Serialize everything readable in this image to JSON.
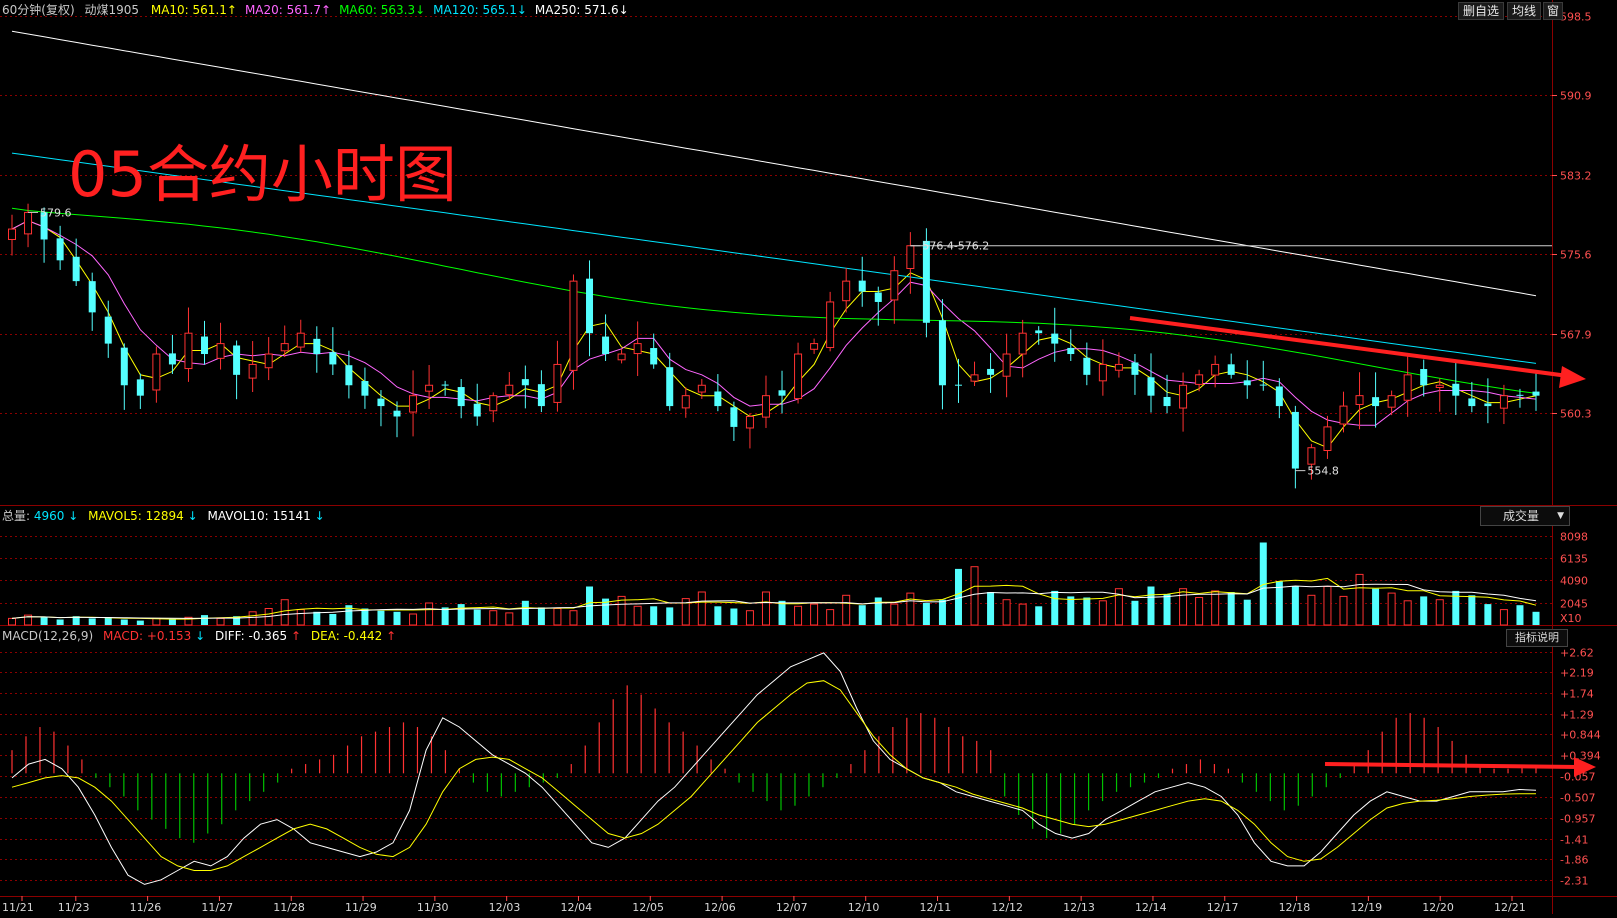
{
  "header": {
    "period": "60分钟(复权)",
    "symbol": "动煤1905",
    "ma": [
      {
        "label": "MA10:",
        "value": "561.1",
        "arrow": "↑",
        "color": "#ffff00"
      },
      {
        "label": "MA20:",
        "value": "561.7",
        "arrow": "↑",
        "color": "#ff66ff"
      },
      {
        "label": "MA60:",
        "value": "563.3",
        "arrow": "↓",
        "color": "#00ff00"
      },
      {
        "label": "MA120:",
        "value": "565.1",
        "arrow": "↓",
        "color": "#00e5ff"
      },
      {
        "label": "MA250:",
        "value": "571.6",
        "arrow": "↓",
        "color": "#ffffff"
      }
    ]
  },
  "toolbar": {
    "delete_label": "删自选",
    "avg_label": "均线",
    "window_label": "窗"
  },
  "annotation": {
    "title": "05合约小时图"
  },
  "volume_header": {
    "total": {
      "label": "总量:",
      "value": "4960",
      "arrow": "↓"
    },
    "mavol5": {
      "label": "MAVOL5:",
      "value": "12894",
      "arrow": "↓"
    },
    "mavol10": {
      "label": "MAVOL10:",
      "value": "15141",
      "arrow": "↓"
    },
    "selector": "成交量"
  },
  "macd_header": {
    "name": "MACD(12,26,9)",
    "macd": {
      "label": "MACD:",
      "value": "+0.153",
      "arrow": "↓"
    },
    "diff": {
      "label": "DIFF:",
      "value": "-0.365",
      "arrow": "↑"
    },
    "dea": {
      "label": "DEA:",
      "value": "-0.442",
      "arrow": "↑"
    },
    "help_button": "指标说明"
  },
  "colors": {
    "up": "#ff3232",
    "down": "#54ffff",
    "ma10": "#ffff00",
    "ma20": "#ff66ff",
    "ma60": "#00ff00",
    "ma120": "#00e5ff",
    "ma250": "#ffffff",
    "grid": "#8b0000",
    "axis_text": "#ff5050"
  },
  "chart_data": [
    {
      "type": "candlestick",
      "title": "05合约小时图",
      "y_ticks": [
        598.5,
        590.9,
        583.2,
        575.6,
        567.9,
        560.3
      ],
      "ylim": [
        551.5,
        600.0
      ],
      "x_labels": [
        "11/21",
        "11/23",
        "11/26",
        "11/27",
        "11/28",
        "11/29",
        "11/30",
        "12/03",
        "12/04",
        "12/05",
        "12/06",
        "12/07",
        "12/10",
        "12/11",
        "12/12",
        "12/13",
        "12/14",
        "12/17",
        "12/18",
        "12/19",
        "12/20",
        "12/21"
      ],
      "callouts": [
        "579.6",
        "576.4-576.2",
        "554.8"
      ],
      "key_points": [
        {
          "session": "11/21",
          "value": 579.6,
          "label": "579.6"
        },
        {
          "session": "12/10",
          "value": 576.4,
          "label": "576.4-576.2"
        },
        {
          "session": "12/18",
          "value": 554.8,
          "label": "554.8"
        }
      ],
      "series": [
        {
          "name": "MA10",
          "last": 561.1
        },
        {
          "name": "MA20",
          "last": 561.7
        },
        {
          "name": "MA60",
          "last": 563.3
        },
        {
          "name": "MA120",
          "last": 565.1
        },
        {
          "name": "MA250",
          "last": 571.6
        }
      ],
      "close_path": [
        578,
        579.6,
        577,
        575,
        573,
        570,
        567,
        563,
        562,
        566,
        565,
        568,
        566,
        567,
        564,
        565,
        566,
        567,
        568,
        566,
        565,
        563,
        562,
        561,
        560,
        562,
        563,
        563,
        561,
        560,
        562,
        563,
        563,
        561,
        565,
        573,
        568,
        566,
        566,
        567,
        565,
        561,
        562,
        563,
        561,
        559,
        560,
        562,
        562,
        566,
        567,
        571,
        573,
        572,
        571,
        574,
        576.4,
        569,
        563,
        563,
        564,
        564,
        566,
        568,
        568,
        567,
        566,
        564,
        565,
        565,
        564,
        562,
        561,
        563,
        564,
        565,
        564,
        563,
        563,
        561,
        555,
        557,
        559,
        561,
        562,
        561,
        562,
        564,
        563,
        563,
        562,
        561,
        561,
        562,
        562,
        562
      ]
    },
    {
      "type": "bar",
      "title": "成交量",
      "y_ticks": [
        8098,
        6135,
        4090,
        2045
      ],
      "y_unit": "X10",
      "series": [
        {
          "name": "总量",
          "last": 4960
        },
        {
          "name": "MAVOL5",
          "last": 12894
        },
        {
          "name": "MAVOL10",
          "last": 15141
        }
      ],
      "values": [
        600,
        900,
        700,
        500,
        800,
        600,
        700,
        500,
        400,
        600,
        500,
        700,
        900,
        600,
        800,
        1200,
        1500,
        2300,
        1400,
        1200,
        1000,
        1800,
        1500,
        1300,
        1200,
        1000,
        2000,
        1600,
        1900,
        1400,
        1300,
        1100,
        2200,
        1600,
        1500,
        1300,
        3500,
        2400,
        2600,
        1700,
        1700,
        1600,
        2400,
        3000,
        1700,
        1500,
        1300,
        3000,
        2200,
        1700,
        1900,
        1400,
        2700,
        1800,
        2500,
        1900,
        2900,
        2000,
        2300,
        5100,
        5300,
        3000,
        2300,
        1900,
        1700,
        3100,
        2600,
        2500,
        2200,
        3300,
        2200,
        3500,
        2800,
        3300,
        2500,
        3100,
        3000,
        2300,
        7500,
        4000,
        3500,
        2700,
        3500,
        2600,
        4600,
        3300,
        2900,
        2200,
        2600,
        2300,
        3100,
        2700,
        1900,
        1400,
        1800,
        1200
      ]
    },
    {
      "type": "bar",
      "title": "MACD(12,26,9)",
      "y_ticks": [
        2.62,
        2.19,
        1.74,
        1.29,
        0.844,
        0.394,
        -0.057,
        -0.507,
        -0.957,
        -1.41,
        -1.86,
        -2.31
      ],
      "y_tick_labels": [
        "+2.62",
        "+2.19",
        "+1.74",
        "+1.29",
        "+0.844",
        "+0.394",
        "-0.057",
        "-0.507",
        "-0.957",
        "-1.41",
        "-1.86",
        "-2.31"
      ],
      "ylim": [
        -2.65,
        2.75
      ],
      "series": [
        {
          "name": "MACD",
          "last": 0.153
        },
        {
          "name": "DIFF",
          "last": -0.365
        },
        {
          "name": "DEA",
          "last": -0.442
        }
      ],
      "macd_hist": [
        0.5,
        0.8,
        1.0,
        0.9,
        0.6,
        0.3,
        -0.1,
        -0.3,
        -0.5,
        -0.8,
        -1.0,
        -1.2,
        -1.4,
        -1.5,
        -1.3,
        -1.1,
        -0.8,
        -0.6,
        -0.4,
        -0.2,
        0.1,
        0.2,
        0.3,
        0.4,
        0.6,
        0.8,
        0.9,
        1.0,
        1.1,
        1.0,
        0.8,
        0.5,
        0.1,
        -0.2,
        -0.4,
        -0.5,
        -0.4,
        -0.3,
        -0.2,
        -0.1,
        0.2,
        0.6,
        1.1,
        1.6,
        1.9,
        1.7,
        1.4,
        1.1,
        0.9,
        0.6,
        0.3,
        0.1,
        -0.2,
        -0.4,
        -0.6,
        -0.8,
        -0.7,
        -0.5,
        -0.3,
        -0.1,
        0.2,
        0.5,
        0.8,
        1.0,
        1.2,
        1.3,
        1.2,
        1.0,
        0.8,
        0.7,
        0.5,
        -0.5,
        -0.9,
        -1.2,
        -1.4,
        -1.3,
        -1.1,
        -0.8,
        -0.6,
        -0.4,
        -0.3,
        -0.2,
        -0.1,
        0.1,
        0.2,
        0.3,
        0.2,
        0.1,
        -0.2,
        -0.4,
        -0.6,
        -0.8,
        -0.7,
        -0.5,
        -0.3,
        -0.1,
        0.2,
        0.5,
        0.9,
        1.2,
        1.3,
        1.2,
        1.0,
        0.7,
        0.4,
        0.2,
        0.1,
        0.1,
        0.15,
        0.153
      ],
      "diff": [
        -0.1,
        0.2,
        0.3,
        0.1,
        -0.3,
        -0.9,
        -1.6,
        -2.2,
        -2.4,
        -2.3,
        -2.1,
        -1.9,
        -2.0,
        -1.8,
        -1.4,
        -1.1,
        -1.0,
        -1.2,
        -1.5,
        -1.6,
        -1.7,
        -1.8,
        -1.7,
        -1.5,
        -0.8,
        0.5,
        1.2,
        1.0,
        0.7,
        0.4,
        0.2,
        0.0,
        -0.3,
        -0.7,
        -1.1,
        -1.5,
        -1.6,
        -1.4,
        -1.0,
        -0.6,
        -0.3,
        0.1,
        0.5,
        0.9,
        1.3,
        1.7,
        2.0,
        2.3,
        2.45,
        2.6,
        2.2,
        1.4,
        0.7,
        0.3,
        0.1,
        -0.1,
        -0.2,
        -0.4,
        -0.5,
        -0.6,
        -0.7,
        -0.8,
        -1.1,
        -1.3,
        -1.4,
        -1.3,
        -1.0,
        -0.8,
        -0.6,
        -0.4,
        -0.3,
        -0.2,
        -0.3,
        -0.5,
        -0.9,
        -1.5,
        -1.9,
        -2.0,
        -2.0,
        -1.7,
        -1.3,
        -0.9,
        -0.6,
        -0.4,
        -0.5,
        -0.6,
        -0.6,
        -0.5,
        -0.4,
        -0.4,
        -0.4,
        -0.35,
        -0.365
      ],
      "dea": [
        -0.3,
        -0.2,
        -0.1,
        -0.05,
        -0.1,
        -0.3,
        -0.6,
        -1.0,
        -1.4,
        -1.8,
        -2.0,
        -2.1,
        -2.1,
        -2.0,
        -1.8,
        -1.6,
        -1.4,
        -1.2,
        -1.1,
        -1.2,
        -1.4,
        -1.6,
        -1.75,
        -1.8,
        -1.6,
        -1.1,
        -0.4,
        0.1,
        0.3,
        0.35,
        0.3,
        0.1,
        -0.1,
        -0.4,
        -0.7,
        -1.0,
        -1.3,
        -1.4,
        -1.3,
        -1.1,
        -0.8,
        -0.5,
        -0.1,
        0.3,
        0.7,
        1.1,
        1.4,
        1.7,
        1.95,
        2.0,
        1.8,
        1.3,
        0.8,
        0.4,
        0.1,
        -0.1,
        -0.2,
        -0.3,
        -0.45,
        -0.55,
        -0.65,
        -0.75,
        -0.9,
        -1.0,
        -1.1,
        -1.15,
        -1.1,
        -1.0,
        -0.9,
        -0.8,
        -0.7,
        -0.6,
        -0.55,
        -0.6,
        -0.8,
        -1.1,
        -1.5,
        -1.8,
        -1.9,
        -1.85,
        -1.6,
        -1.3,
        -1.0,
        -0.75,
        -0.65,
        -0.6,
        -0.58,
        -0.55,
        -0.5,
        -0.47,
        -0.45,
        -0.44,
        -0.442
      ]
    }
  ]
}
